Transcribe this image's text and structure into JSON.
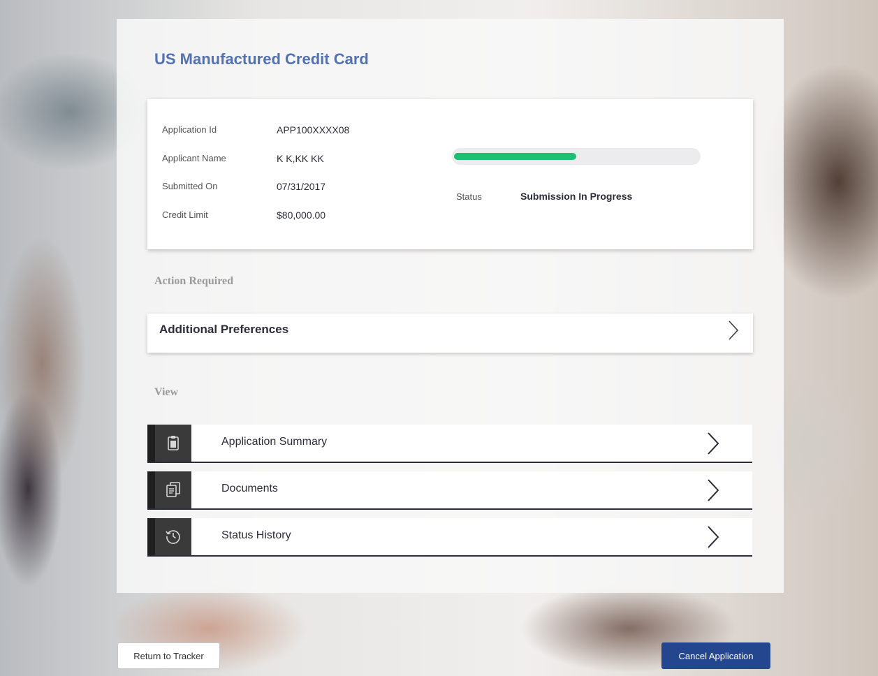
{
  "title": "US Manufactured Credit Card",
  "application": {
    "fields": [
      {
        "label": "Application Id",
        "value": "APP100XXXX08"
      },
      {
        "label": "Applicant Name",
        "value": "K K,KK KK"
      },
      {
        "label": "Submitted On",
        "value": "07/31/2017"
      },
      {
        "label": "Credit Limit",
        "value": "$80,000.00"
      }
    ],
    "progress_fraction": 0.5,
    "status_label": "Status",
    "status_value": "Submission In Progress"
  },
  "action_required": {
    "heading": "Action Required",
    "items": [
      {
        "label": "Additional Preferences",
        "icon": "chevron-right-icon"
      }
    ]
  },
  "view": {
    "heading": "View",
    "items": [
      {
        "label": "Application Summary",
        "icon": "clipboard-icon"
      },
      {
        "label": "Documents",
        "icon": "documents-icon"
      },
      {
        "label": "Status History",
        "icon": "history-clock-icon"
      }
    ]
  },
  "buttons": {
    "return_label": "Return to Tracker",
    "cancel_label": "Cancel Application"
  },
  "colors": {
    "title": "#5272b1",
    "progress": "#1dbf73",
    "primary_button": "#24468f"
  }
}
